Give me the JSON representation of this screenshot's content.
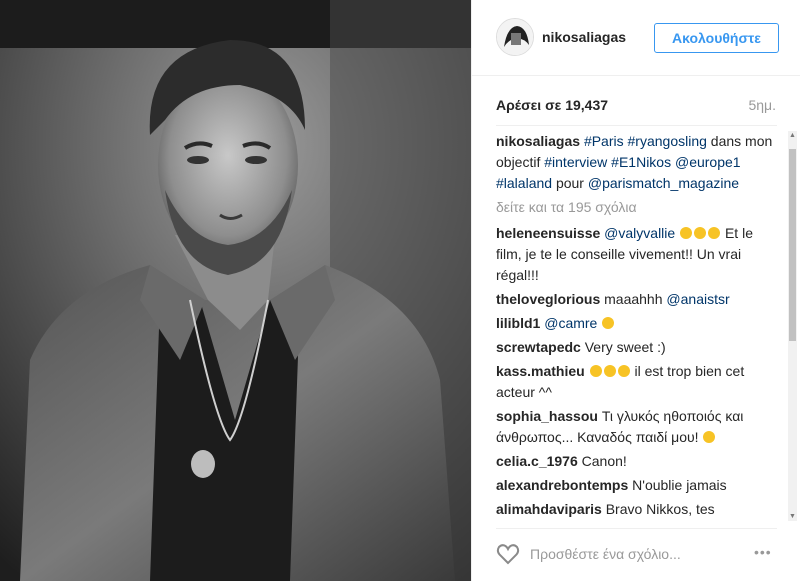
{
  "post": {
    "username": "nikosaliagas",
    "follow_label": "Ακολουθήστε",
    "likes_text": "Αρέσει σε 19,437",
    "time_text": "5ημ.",
    "view_all_comments": "δείτε και τα 195 σχόλια",
    "comment_placeholder": "Προσθέστε ένα σχόλιο...",
    "more_label": "•••"
  },
  "caption": {
    "author": "nikosaliagas",
    "parts": [
      {
        "text": "#Paris",
        "mention": true
      },
      {
        "text": " ",
        "mention": false
      },
      {
        "text": "#ryangosling",
        "mention": true
      },
      {
        "text": " dans mon objectif ",
        "mention": false
      },
      {
        "text": "#interview",
        "mention": true
      },
      {
        "text": " ",
        "mention": false
      },
      {
        "text": "#E1Nikos",
        "mention": true
      },
      {
        "text": " ",
        "mention": false
      },
      {
        "text": "@europe1",
        "mention": true
      },
      {
        "text": " ",
        "mention": false
      },
      {
        "text": "#lalaland",
        "mention": true
      },
      {
        "text": " pour ",
        "mention": false
      },
      {
        "text": "@parismatch_magazine",
        "mention": true
      }
    ]
  },
  "comments": [
    {
      "author": "heleneensuisse",
      "mention": "@valyvallie",
      "emojis": 3,
      "text": " Et le film, je te le conseille vivement!! Un vrai régal!!!"
    },
    {
      "author": "theloveglorious",
      "text": "maaahhh ",
      "mention_end": "@anaistsr"
    },
    {
      "author": "lilibld1",
      "mention": "@camre",
      "emojis": 1,
      "text": ""
    },
    {
      "author": "screwtapedc",
      "text": "Very sweet :)"
    },
    {
      "author": "kass.mathieu",
      "emojis_before": 3,
      "text": " il est trop bien cet acteur ^^"
    },
    {
      "author": "sophia_hassou",
      "text": "Τι γλυκός ηθοποιός και άνθρωπος... Καναδός παιδί μου! ",
      "emojis_after": 1
    },
    {
      "author": "celia.c_1976",
      "text": "Canon!"
    },
    {
      "author": "alexandrebontemps",
      "text": "N'oublie jamais"
    },
    {
      "author": "alimahdaviparis",
      "text": "Bravo Nikkos, tes"
    }
  ],
  "icons": {
    "heart": "heart-icon",
    "avatar": "avatar",
    "more": "more-options-icon"
  },
  "colors": {
    "accent": "#3897f0",
    "mention": "#003569",
    "muted": "#999999",
    "text": "#262626"
  }
}
